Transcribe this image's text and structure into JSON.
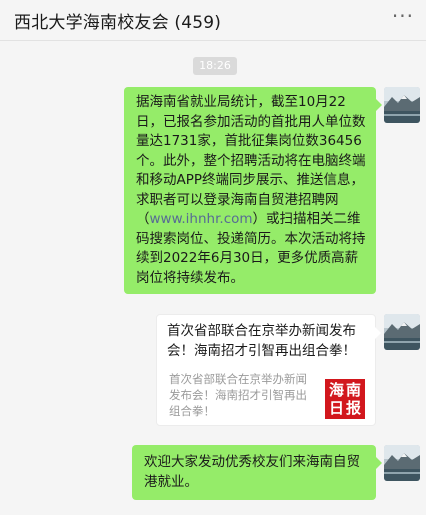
{
  "header": {
    "title": "西北大学海南校友会 (459)",
    "more_label": "···"
  },
  "timestamp": "18:26",
  "messages": [
    {
      "text_before": "据海南省就业局统计，截至10月22日，已报名参加活动的首批用人单位数量达1731家，首批征集岗位数36456个。此外，整个招聘活动将在电脑终端和移动APP终端同步展示、推送信息，求职者可以登录海南自贸港招聘网（",
      "link": "www.ihnhr.com",
      "text_after": "）或扫描相关二维码搜索岗位、投递简历。本次活动将持续到2022年6月30日，更多优质高薪岗位将持续发布。"
    },
    {
      "card_title": "首次省部联合在京举办新闻发布会！海南招才引智再出组合拳！",
      "card_desc": "首次省部联合在京举办新闻发布会！海南招才引智再出组合拳！",
      "logo_text": [
        "海",
        "南",
        "日",
        "报"
      ]
    },
    {
      "text": "欢迎大家发动优秀校友们来海南自贸港就业。"
    }
  ],
  "icons": {
    "avatar": "landscape-avatar-icon",
    "more": "more-options-icon",
    "logo": "hainan-daily-logo"
  },
  "colors": {
    "bubble_green": "#95ec69",
    "link": "#576b95",
    "logo_red": "#d2171d"
  }
}
